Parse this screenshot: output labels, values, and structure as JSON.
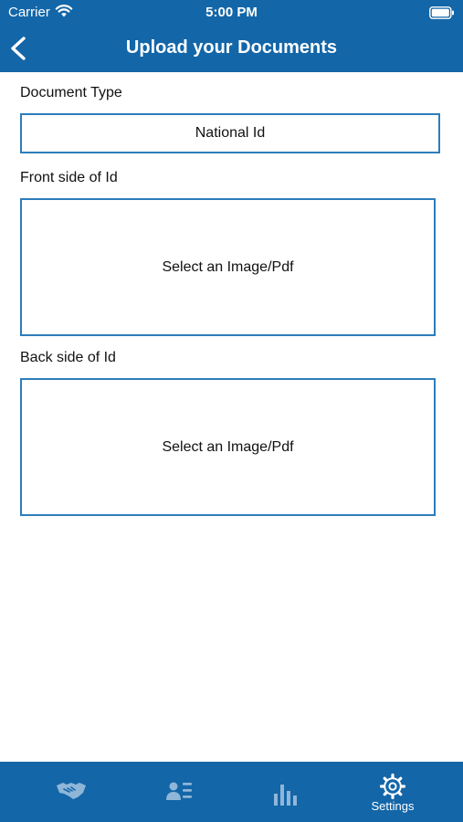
{
  "status_bar": {
    "carrier": "Carrier",
    "time": "5:00 PM"
  },
  "header": {
    "title": "Upload your Documents"
  },
  "document_type": {
    "label": "Document Type",
    "value": "National Id"
  },
  "front_side": {
    "label": "Front side of Id",
    "placeholder": "Select an Image/Pdf"
  },
  "back_side": {
    "label": "Back side of Id",
    "placeholder": "Select an Image/Pdf"
  },
  "tabbar": {
    "tabs": [
      {
        "icon": "handshake-icon",
        "label": ""
      },
      {
        "icon": "contacts-list-icon",
        "label": ""
      },
      {
        "icon": "bar-chart-icon",
        "label": ""
      },
      {
        "icon": "gear-icon",
        "label": "Settings"
      }
    ]
  },
  "colors": {
    "primary": "#1366a8",
    "border": "#2d7dbb",
    "inactive_icon": "#8fb6d8"
  }
}
